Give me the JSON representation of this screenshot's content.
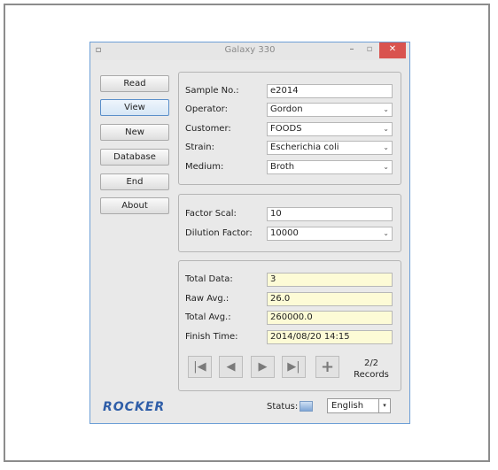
{
  "window": {
    "title": "Galaxy 330"
  },
  "nav_buttons": [
    "Read",
    "View",
    "New",
    "Database",
    "End",
    "About"
  ],
  "sample_group": {
    "fields": [
      {
        "label": "Sample No.:",
        "value": "e2014",
        "dropdown": false
      },
      {
        "label": "Operator:",
        "value": "Gordon",
        "dropdown": true
      },
      {
        "label": "Customer:",
        "value": "FOODS",
        "dropdown": true
      },
      {
        "label": "Strain:",
        "value": "Escherichia coli",
        "dropdown": true
      },
      {
        "label": "Medium:",
        "value": "Broth",
        "dropdown": true
      }
    ]
  },
  "factor_group": {
    "fields": [
      {
        "label": "Factor Scal:",
        "value": "10",
        "dropdown": false
      },
      {
        "label": "Dilution Factor:",
        "value": "10000",
        "dropdown": true
      }
    ]
  },
  "results_group": {
    "fields": [
      {
        "label": "Total Data:",
        "value": "3"
      },
      {
        "label": "Raw Avg.:",
        "value": "26.0"
      },
      {
        "label": "Total Avg.:",
        "value": "260000.0"
      },
      {
        "label": "Finish Time:",
        "value": "2014/08/20 14:15"
      }
    ],
    "record_nav_icons": [
      "first-record-icon",
      "previous-record-icon",
      "next-record-icon",
      "last-record-icon",
      "add-record-icon"
    ],
    "records_line1": "2/2",
    "records_line2": "Records"
  },
  "footer": {
    "logo": "ROCKER",
    "status_label": "Status:",
    "language": "English"
  },
  "colors": {
    "accent_blue": "#2f5ea8",
    "highlight_field": "#fdfbd6",
    "close_button": "#d9534f"
  }
}
